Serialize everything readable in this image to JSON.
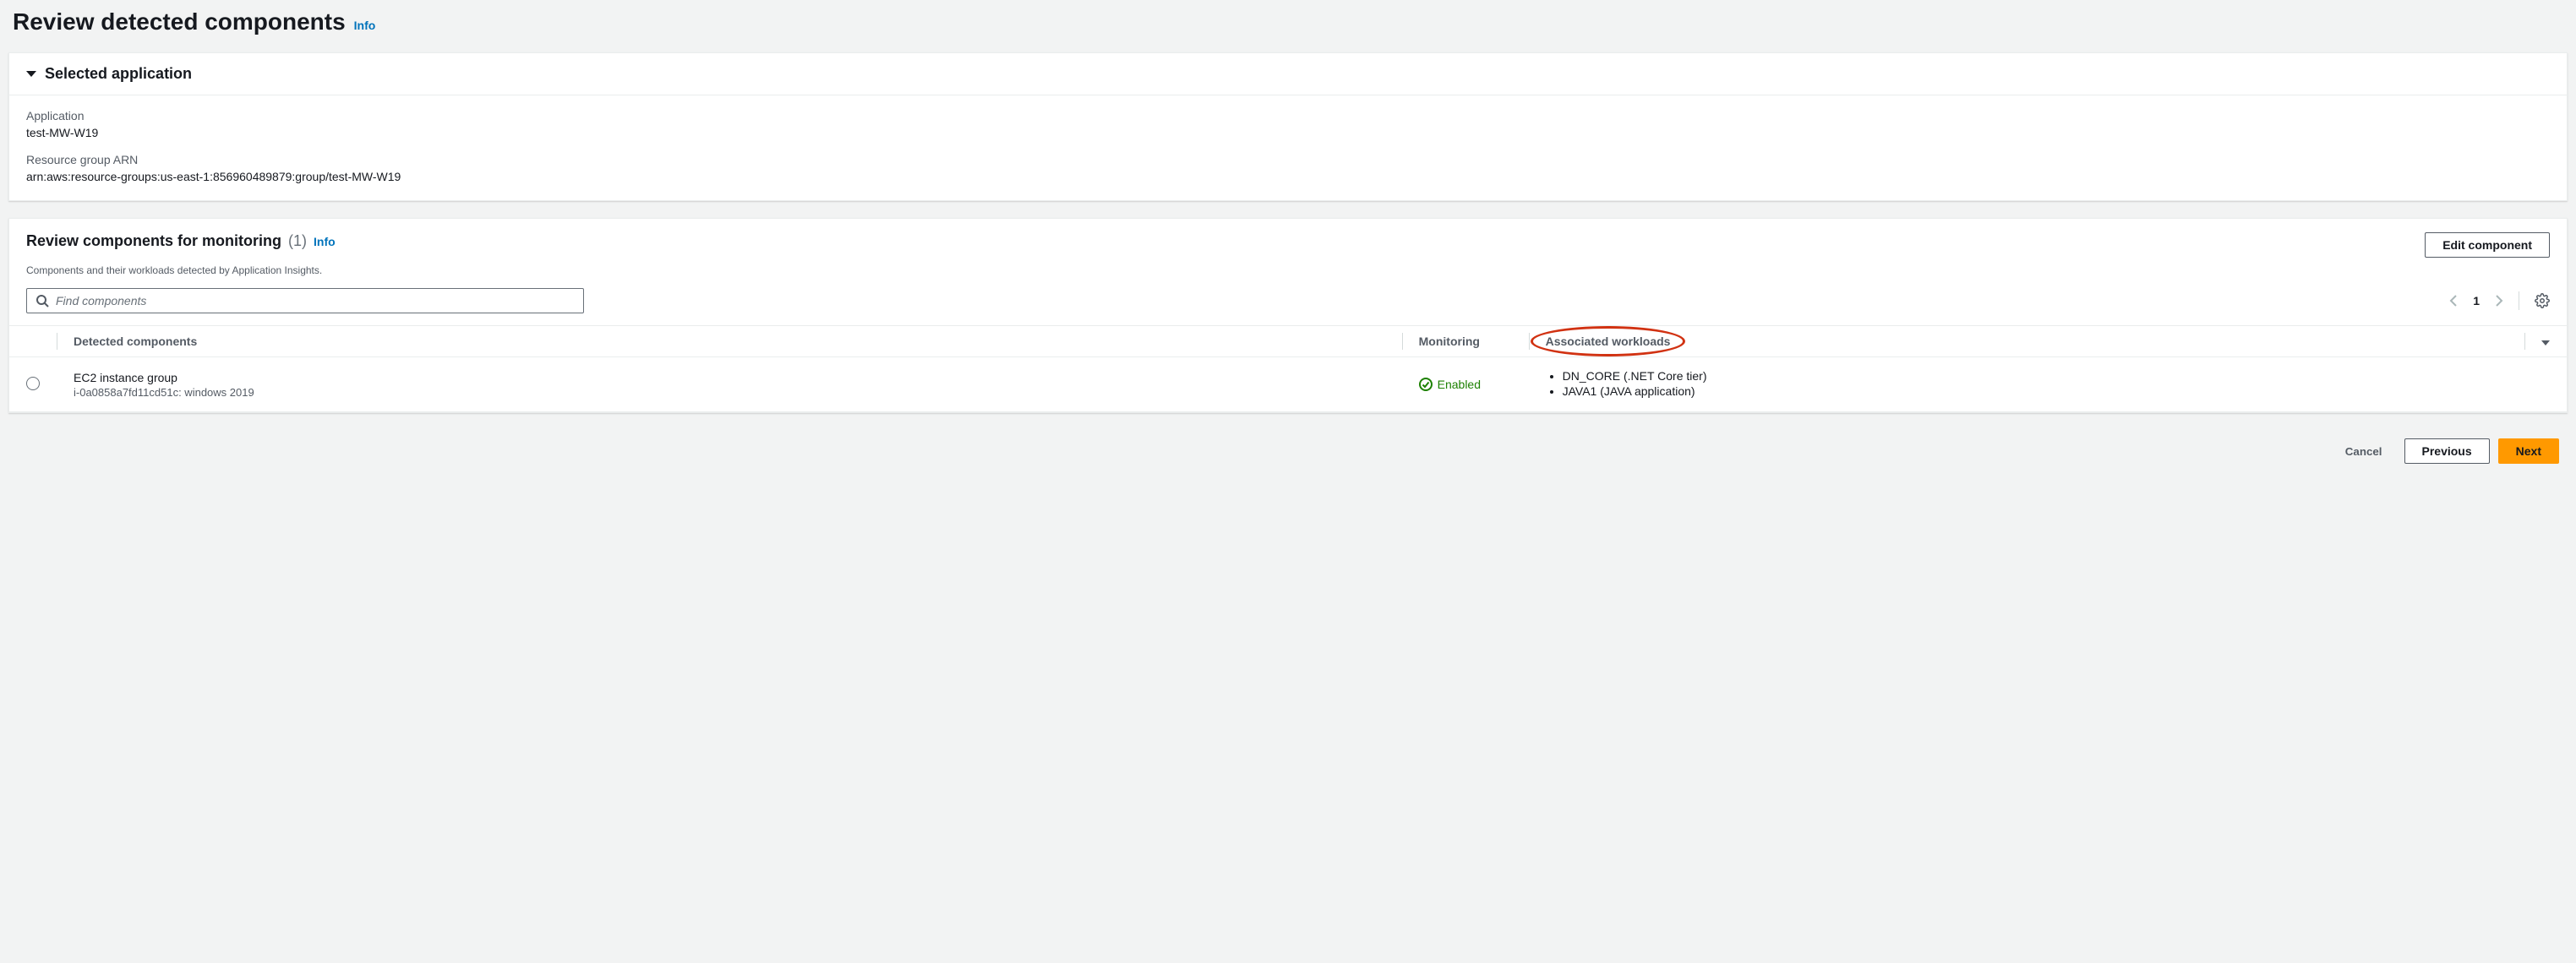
{
  "page": {
    "title": "Review detected components",
    "info": "Info"
  },
  "selected_app": {
    "panel_title": "Selected application",
    "application_label": "Application",
    "application_value": "test-MW-W19",
    "arn_label": "Resource group ARN",
    "arn_value": "arn:aws:resource-groups:us-east-1:856960489879:group/test-MW-W19"
  },
  "review": {
    "title": "Review components for monitoring",
    "count": "(1)",
    "info": "Info",
    "description": "Components and their workloads detected by Application Insights.",
    "edit_button": "Edit component",
    "search_placeholder": "Find components",
    "page_number": "1",
    "columns": {
      "detected": "Detected components",
      "monitoring": "Monitoring",
      "workloads": "Associated workloads"
    },
    "rows": [
      {
        "name": "EC2 instance group",
        "sub": "i-0a0858a7fd11cd51c: windows 2019",
        "monitoring": "Enabled",
        "workloads": [
          "DN_CORE (.NET Core tier)",
          "JAVA1 (JAVA application)"
        ]
      }
    ]
  },
  "footer": {
    "cancel": "Cancel",
    "previous": "Previous",
    "next": "Next"
  }
}
